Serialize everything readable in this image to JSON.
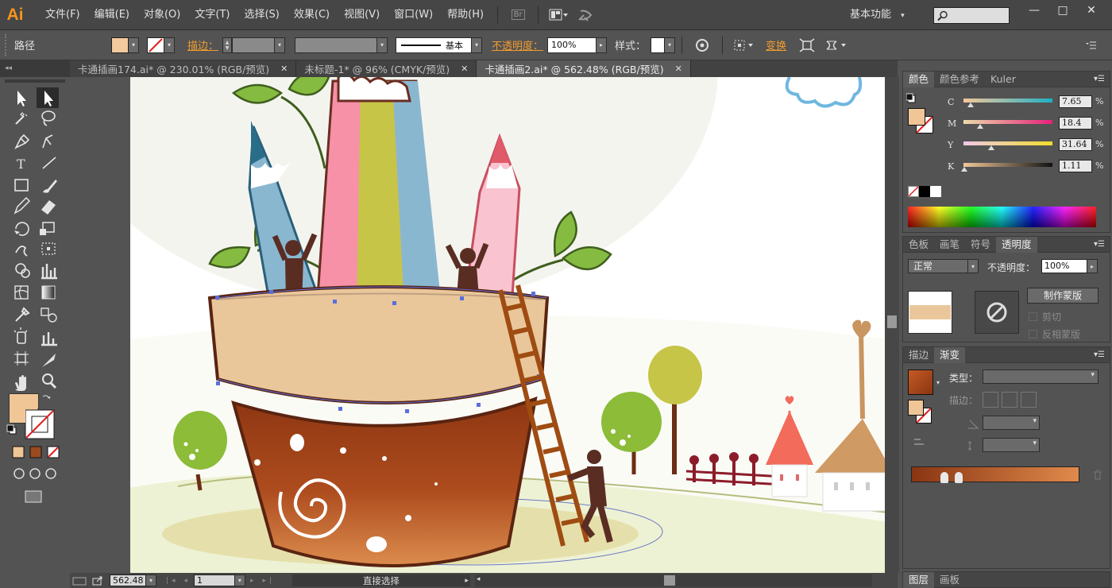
{
  "menubar": {
    "logo": "Ai",
    "items": [
      "文件(F)",
      "编辑(E)",
      "对象(O)",
      "文字(T)",
      "选择(S)",
      "效果(C)",
      "视图(V)",
      "窗口(W)",
      "帮助(H)"
    ],
    "bridge_label": "Br",
    "workspace": "基本功能",
    "workspace_arrow": "▾",
    "search_icon": "search-icon",
    "minimize": "—",
    "restore": "□",
    "close": "✕"
  },
  "control_bar": {
    "object_type": "路径",
    "stroke_label": "描边：",
    "stroke_profile": "基本",
    "opacity_label": "不透明度：",
    "opacity_value": "100%",
    "style_label": "样式：",
    "transform_label": "变换",
    "fill_color": "#f3c99e",
    "arrow": "▾",
    "right_arrow": "▸"
  },
  "tabs": [
    {
      "label": "卡通插画174.ai* @ 230.01% (RGB/预览)",
      "close": "✕"
    },
    {
      "label": "未标题-1* @ 96% (CMYK/预览)",
      "close": "✕"
    },
    {
      "label": "卡通插画2.ai* @ 562.48% (RGB/预览)",
      "close": "✕"
    }
  ],
  "collapse_glyph": "◂◂",
  "color_panel": {
    "tabs": [
      "颜色",
      "颜色参考",
      "Kuler"
    ],
    "menu_glyph": "▾☰",
    "sliders": [
      {
        "label": "C",
        "value": "7.65",
        "unit": "%",
        "level": 0.0765
      },
      {
        "label": "M",
        "value": "18.4",
        "unit": "%",
        "level": 0.184
      },
      {
        "label": "Y",
        "value": "31.64",
        "unit": "%",
        "level": 0.3164
      },
      {
        "label": "K",
        "value": "1.11",
        "unit": "%",
        "level": 0.0111
      }
    ],
    "fill_color": "#f0c697"
  },
  "transparency_panel": {
    "tabs": [
      "色板",
      "画笔",
      "符号",
      "透明度"
    ],
    "blend_mode": "正常",
    "opacity_label": "不透明度：",
    "opacity_value": "100%",
    "make_mask_button": "制作蒙版",
    "clip_label": "剪切",
    "invert_label": "反相蒙版"
  },
  "gradient_panel": {
    "tabs": [
      "描边",
      "渐变"
    ],
    "type_label": "类型：",
    "stroke_label": "描边：",
    "gradient_start": "#8a3512",
    "gradient_end": "#e08a4c"
  },
  "layers_panel": {
    "tabs": [
      "图层",
      "画板"
    ]
  },
  "status": {
    "zoom": "562.48",
    "artboard": "1",
    "tool_name": "直接选择"
  },
  "artwork_colors": {
    "pot_rim": "#eac79b",
    "pot_body": "#a8461c",
    "pencil_blue": "#8ab7d0",
    "pencil_pink": "#f691a7",
    "pencil_green": "#c6c547",
    "leaf": "#86bb41",
    "tree": "#8cbc38",
    "ground": "#eef2d4",
    "ladder": "#9f4c12",
    "figure": "#5a2d23"
  }
}
